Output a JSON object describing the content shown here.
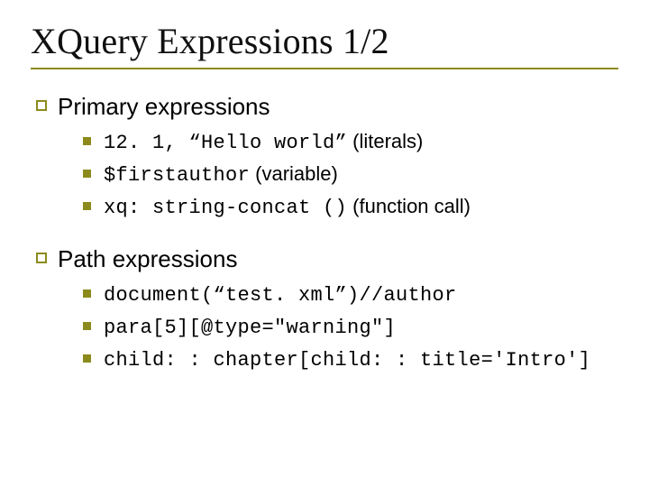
{
  "title": "XQuery Expressions 1/2",
  "sections": [
    {
      "label": "Primary expressions",
      "items": [
        {
          "code": "12. 1, “Hello world”",
          "annotation": " (literals)"
        },
        {
          "code": "$firstauthor",
          "annotation": " (variable)"
        },
        {
          "code": "xq: string-concat ()",
          "annotation": " (function call)"
        }
      ]
    },
    {
      "label": "Path expressions",
      "items": [
        {
          "code": "document(“test. xml”)//author",
          "annotation": ""
        },
        {
          "code": "para[5][@type=\"warning\"]",
          "annotation": ""
        },
        {
          "code": "child: : chapter[child: : title='Intro']",
          "annotation": ""
        }
      ]
    }
  ]
}
